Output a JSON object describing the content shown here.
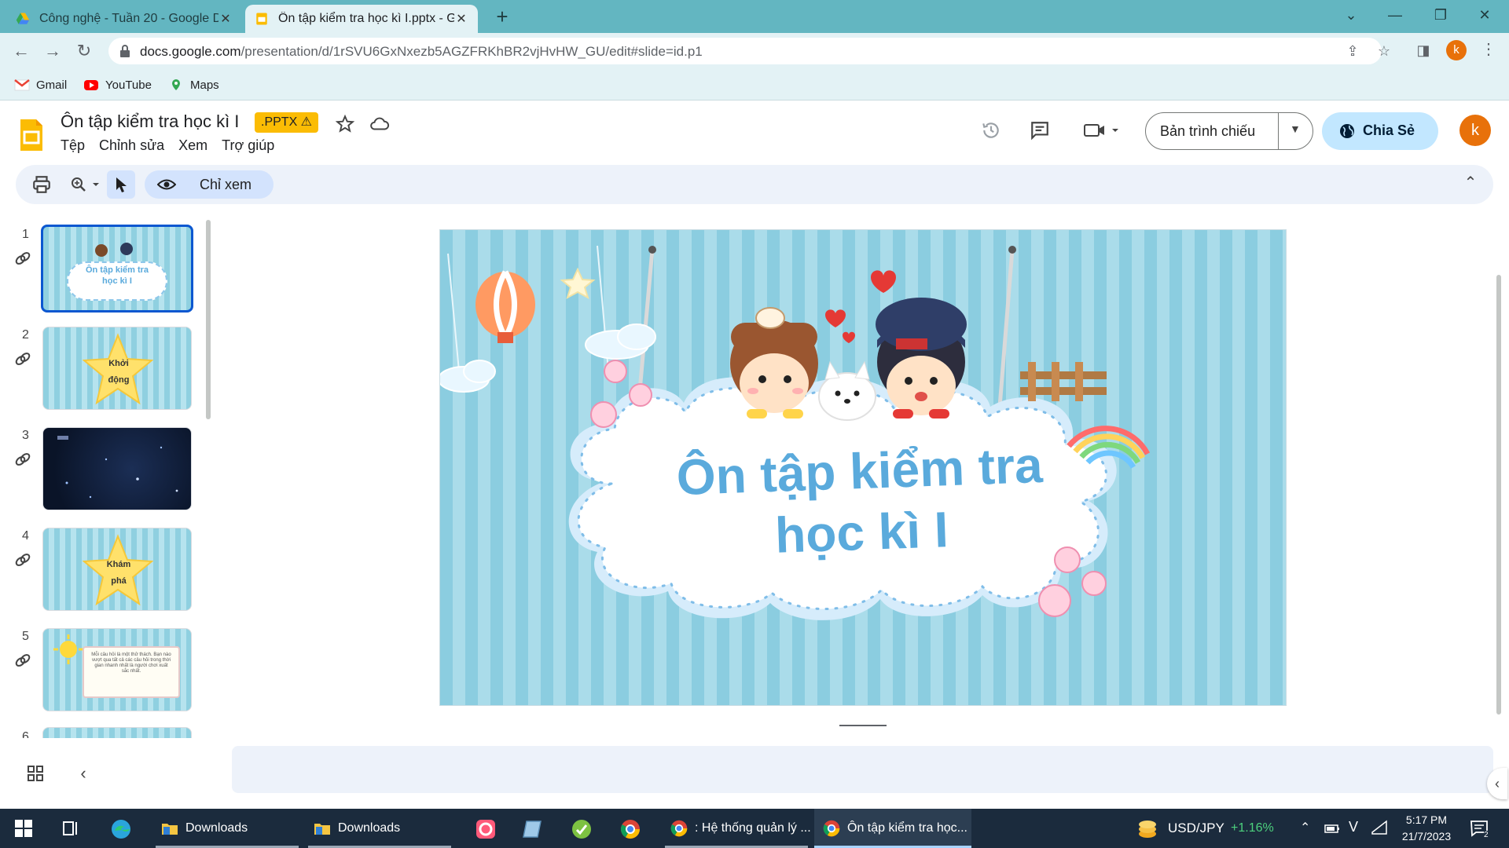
{
  "browser": {
    "tabs": [
      {
        "title": "Công nghệ - Tuần 20 - Google D",
        "icon": "google-drive-icon",
        "active": false
      },
      {
        "title": "Ôn tập kiểm tra học kì I.pptx - Gc",
        "icon": "google-slides-icon",
        "active": true
      }
    ],
    "url_host": "docs.google.com",
    "url_path": "/presentation/d/1rSVU6GxNxezb5AGZFRKhBR2vjHvHW_GU/edit#slide=id.p1",
    "profile_initial": "k",
    "bookmarks": [
      {
        "label": "Gmail",
        "icon": "gmail-icon"
      },
      {
        "label": "YouTube",
        "icon": "youtube-icon"
      },
      {
        "label": "Maps",
        "icon": "maps-icon"
      }
    ]
  },
  "app": {
    "title": "Ôn tập kiểm tra học kì I",
    "badge": ".PPTX ⚠",
    "menus": [
      "Tệp",
      "Chỉnh sửa",
      "Xem",
      "Trợ giúp"
    ],
    "present_label": "Bản trình chiếu",
    "share_label": "Chia Sẻ",
    "user_initial": "k",
    "view_only_label": "Chỉ xem"
  },
  "filmstrip": [
    {
      "num": "1",
      "text": "Ôn tập kiểm tra học kì I"
    },
    {
      "num": "2",
      "text": "Khởi động"
    },
    {
      "num": "3",
      "text": ""
    },
    {
      "num": "4",
      "text": "Khám phá"
    },
    {
      "num": "5",
      "text": "Mỗi câu hỏi là một thử thách. Bạn nào vượt qua tất cả các câu hỏi trong thời gian nhanh nhất là người chơi xuất sắc nhất."
    },
    {
      "num": "6",
      "text": ""
    }
  ],
  "slide": {
    "title_line1": "Ôn tập kiểm tra",
    "title_line2": "học kì I"
  },
  "taskbar": {
    "items": [
      "Downloads",
      "Downloads",
      ": Hệ thống quản lý ...",
      "Ôn tập kiểm tra học..."
    ],
    "ticker_label": "USD/JPY",
    "ticker_change": "+1.16%",
    "time": "5:17 PM",
    "date": "21/7/2023"
  },
  "colors": {
    "tab_bar": "#63b6c1",
    "address_bar": "#e3f2f5",
    "accent_blue": "#0b57d0",
    "share_button": "#c2e7ff",
    "badge": "#fbbc04",
    "slide_title": "#5aaadc",
    "taskbar": "#1b2b3d"
  }
}
